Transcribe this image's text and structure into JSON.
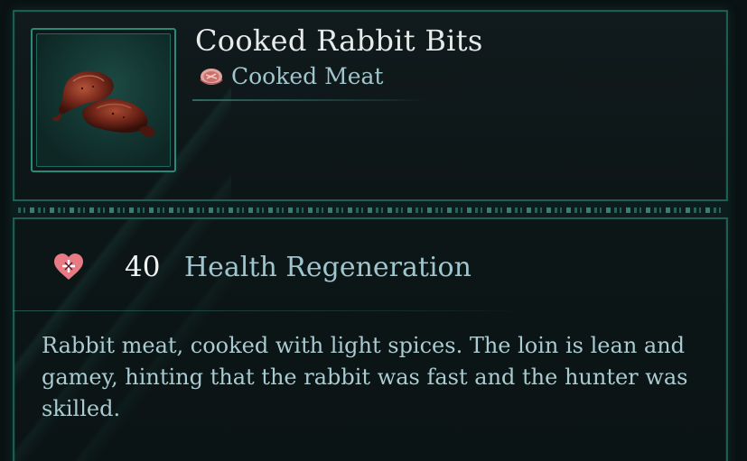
{
  "item": {
    "name": "Cooked Rabbit Bits",
    "category": "Cooked Meat",
    "icon": "cooked-meat-icon",
    "image": "cooked-rabbit-leg-image"
  },
  "stats": [
    {
      "icon": "health-heart-icon",
      "value": "40",
      "label": "Health Regeneration"
    }
  ],
  "description": "Rabbit meat, cooked with light spices. The loin is lean and gamey, hinting that the rabbit was fast and the hunter was skilled.",
  "colors": {
    "frame_border": "#1e5c52",
    "title_text": "#e6ebe9",
    "label_text": "#9fc6cf",
    "heart": "#e87a86"
  }
}
